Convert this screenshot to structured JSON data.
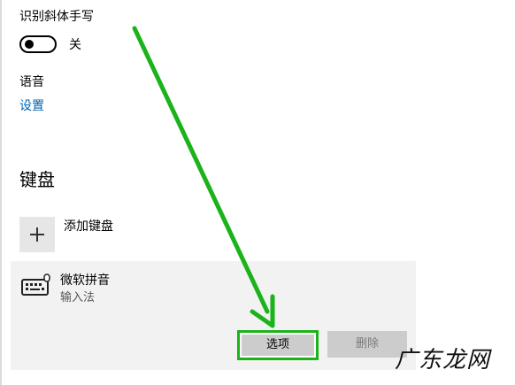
{
  "handwriting": {
    "italic_label": "识别斜体手写",
    "toggle_state": "关",
    "toggle_on": false
  },
  "speech": {
    "label": "语音",
    "settings_link": "设置"
  },
  "keyboard": {
    "heading": "键盘",
    "add_keyboard_label": "添加键盘",
    "installed": {
      "name": "微软拼音",
      "type": "输入法"
    },
    "options_button": "选项",
    "delete_button": "删除"
  },
  "watermark": "广东龙网",
  "colors": {
    "link": "#0063b1",
    "annotation_green": "#1ab31a",
    "panel_bg": "#f2f2f2",
    "button_bg": "#cccccc"
  },
  "icons": {
    "add": "plus-icon",
    "keyboard": "keyboard-icon",
    "annotation": "arrow-annotation-icon"
  }
}
